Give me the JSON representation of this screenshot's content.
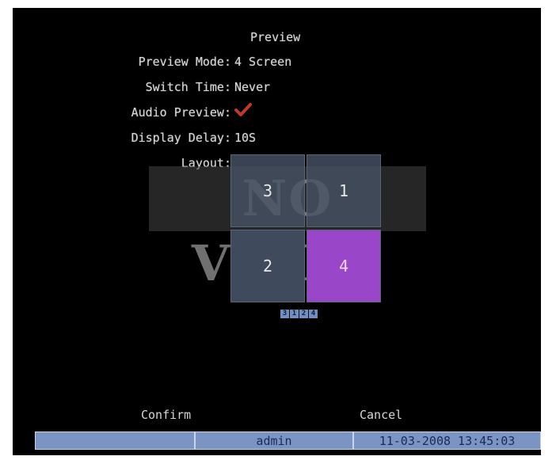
{
  "menu": {
    "title": "Preview",
    "fields": {
      "preview_mode": {
        "label": "Preview Mode:",
        "value": "4 Screen"
      },
      "switch_time": {
        "label": "Switch Time:",
        "value": "Never"
      },
      "audio_preview": {
        "label": "Audio Preview:",
        "checked": true,
        "check_color": "#c0392b"
      },
      "display_delay": {
        "label": "Display Delay:",
        "value": "10S"
      },
      "layout": {
        "label": "Layout:"
      }
    }
  },
  "layout": {
    "overlay_text": "NO VIDEO",
    "cells": [
      "3",
      "1",
      "2",
      "4"
    ],
    "selected_cell": "4",
    "selected_color": "#9a46c9",
    "sequence": [
      "3",
      "1",
      "2",
      "4"
    ]
  },
  "buttons": {
    "confirm": "Confirm",
    "cancel": "Cancel"
  },
  "status_bar": {
    "left": "",
    "user": "admin",
    "datetime": "11-03-2008 13:45:03"
  }
}
